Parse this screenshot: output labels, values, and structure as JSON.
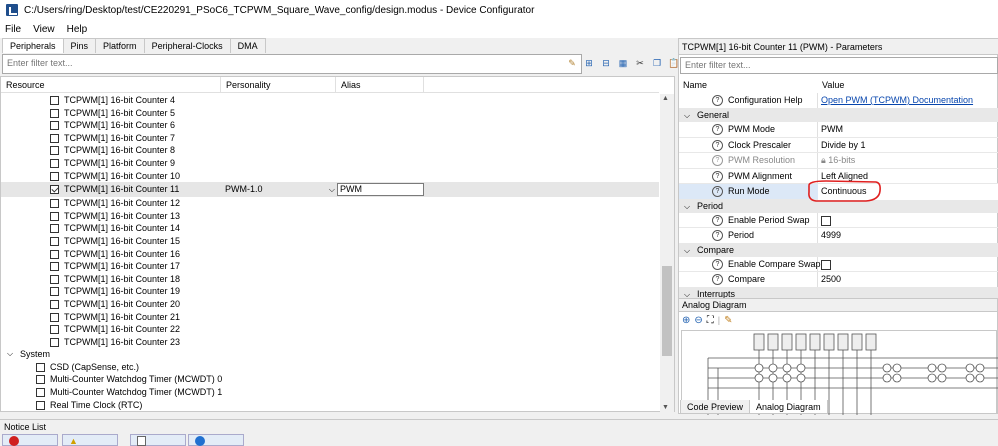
{
  "window": {
    "title": "C:/Users/ring/Desktop/test/CE220291_PSoC6_TCPWM_Square_Wave_config/design.modus - Device Configurator"
  },
  "menu": {
    "items": [
      "File",
      "View",
      "Help"
    ]
  },
  "tabs": [
    "Peripherals",
    "Pins",
    "Platform",
    "Peripheral-Clocks",
    "DMA"
  ],
  "left": {
    "filter_placeholder": "Enter filter text...",
    "columns": {
      "resource": "Resource",
      "personality": "Personality",
      "alias": "Alias"
    },
    "counters": [
      {
        "label": "TCPWM[1] 16-bit Counter 4",
        "checked": false
      },
      {
        "label": "TCPWM[1] 16-bit Counter 5",
        "checked": false
      },
      {
        "label": "TCPWM[1] 16-bit Counter 6",
        "checked": false
      },
      {
        "label": "TCPWM[1] 16-bit Counter 7",
        "checked": false
      },
      {
        "label": "TCPWM[1] 16-bit Counter 8",
        "checked": false
      },
      {
        "label": "TCPWM[1] 16-bit Counter 9",
        "checked": false
      },
      {
        "label": "TCPWM[1] 16-bit Counter 10",
        "checked": false
      },
      {
        "label": "TCPWM[1] 16-bit Counter 11",
        "checked": true,
        "personality": "PWM-1.0",
        "alias": "PWM"
      },
      {
        "label": "TCPWM[1] 16-bit Counter 12",
        "checked": false
      },
      {
        "label": "TCPWM[1] 16-bit Counter 13",
        "checked": false
      },
      {
        "label": "TCPWM[1] 16-bit Counter 14",
        "checked": false
      },
      {
        "label": "TCPWM[1] 16-bit Counter 15",
        "checked": false
      },
      {
        "label": "TCPWM[1] 16-bit Counter 16",
        "checked": false
      },
      {
        "label": "TCPWM[1] 16-bit Counter 17",
        "checked": false
      },
      {
        "label": "TCPWM[1] 16-bit Counter 18",
        "checked": false
      },
      {
        "label": "TCPWM[1] 16-bit Counter 19",
        "checked": false
      },
      {
        "label": "TCPWM[1] 16-bit Counter 20",
        "checked": false
      },
      {
        "label": "TCPWM[1] 16-bit Counter 21",
        "checked": false
      },
      {
        "label": "TCPWM[1] 16-bit Counter 22",
        "checked": false
      },
      {
        "label": "TCPWM[1] 16-bit Counter 23",
        "checked": false
      }
    ],
    "system_group": "System",
    "system_items": [
      "CSD (CapSense, etc.)",
      "Multi-Counter Watchdog Timer (MCWDT) 0",
      "Multi-Counter Watchdog Timer (MCWDT) 1",
      "Real Time Clock (RTC)"
    ]
  },
  "right": {
    "header": "TCPWM[1] 16-bit Counter 11 (PWM) - Parameters",
    "filter_placeholder": "Enter filter text...",
    "col_name": "Name",
    "col_value": "Value",
    "config_help": {
      "name": "Configuration Help",
      "value": "Open PWM (TCPWM) Documentation"
    },
    "groups": {
      "general": "General",
      "period": "Period",
      "compare": "Compare",
      "interrupts": "Interrupts"
    },
    "general": [
      {
        "name": "PWM Mode",
        "value": "PWM"
      },
      {
        "name": "Clock Prescaler",
        "value": "Divide by 1"
      },
      {
        "name": "PWM Resolution",
        "value": "16-bits"
      },
      {
        "name": "PWM Alignment",
        "value": "Left Aligned"
      },
      {
        "name": "Run Mode",
        "value": "Continuous"
      }
    ],
    "period": [
      {
        "name": "Enable Period Swap"
      },
      {
        "name": "Period",
        "value": "4999"
      }
    ],
    "compare": [
      {
        "name": "Enable Compare Swap"
      },
      {
        "name": "Compare",
        "value": "2500"
      }
    ]
  },
  "analog": {
    "header": "Analog Diagram"
  },
  "bottom_tabs": [
    "Code Preview",
    "Analog Diagram"
  ],
  "notice": {
    "label": "Notice List"
  },
  "colors": {
    "selected_row": "#e6e6e6",
    "link": "#0645ad",
    "annotation": "#e02020"
  }
}
